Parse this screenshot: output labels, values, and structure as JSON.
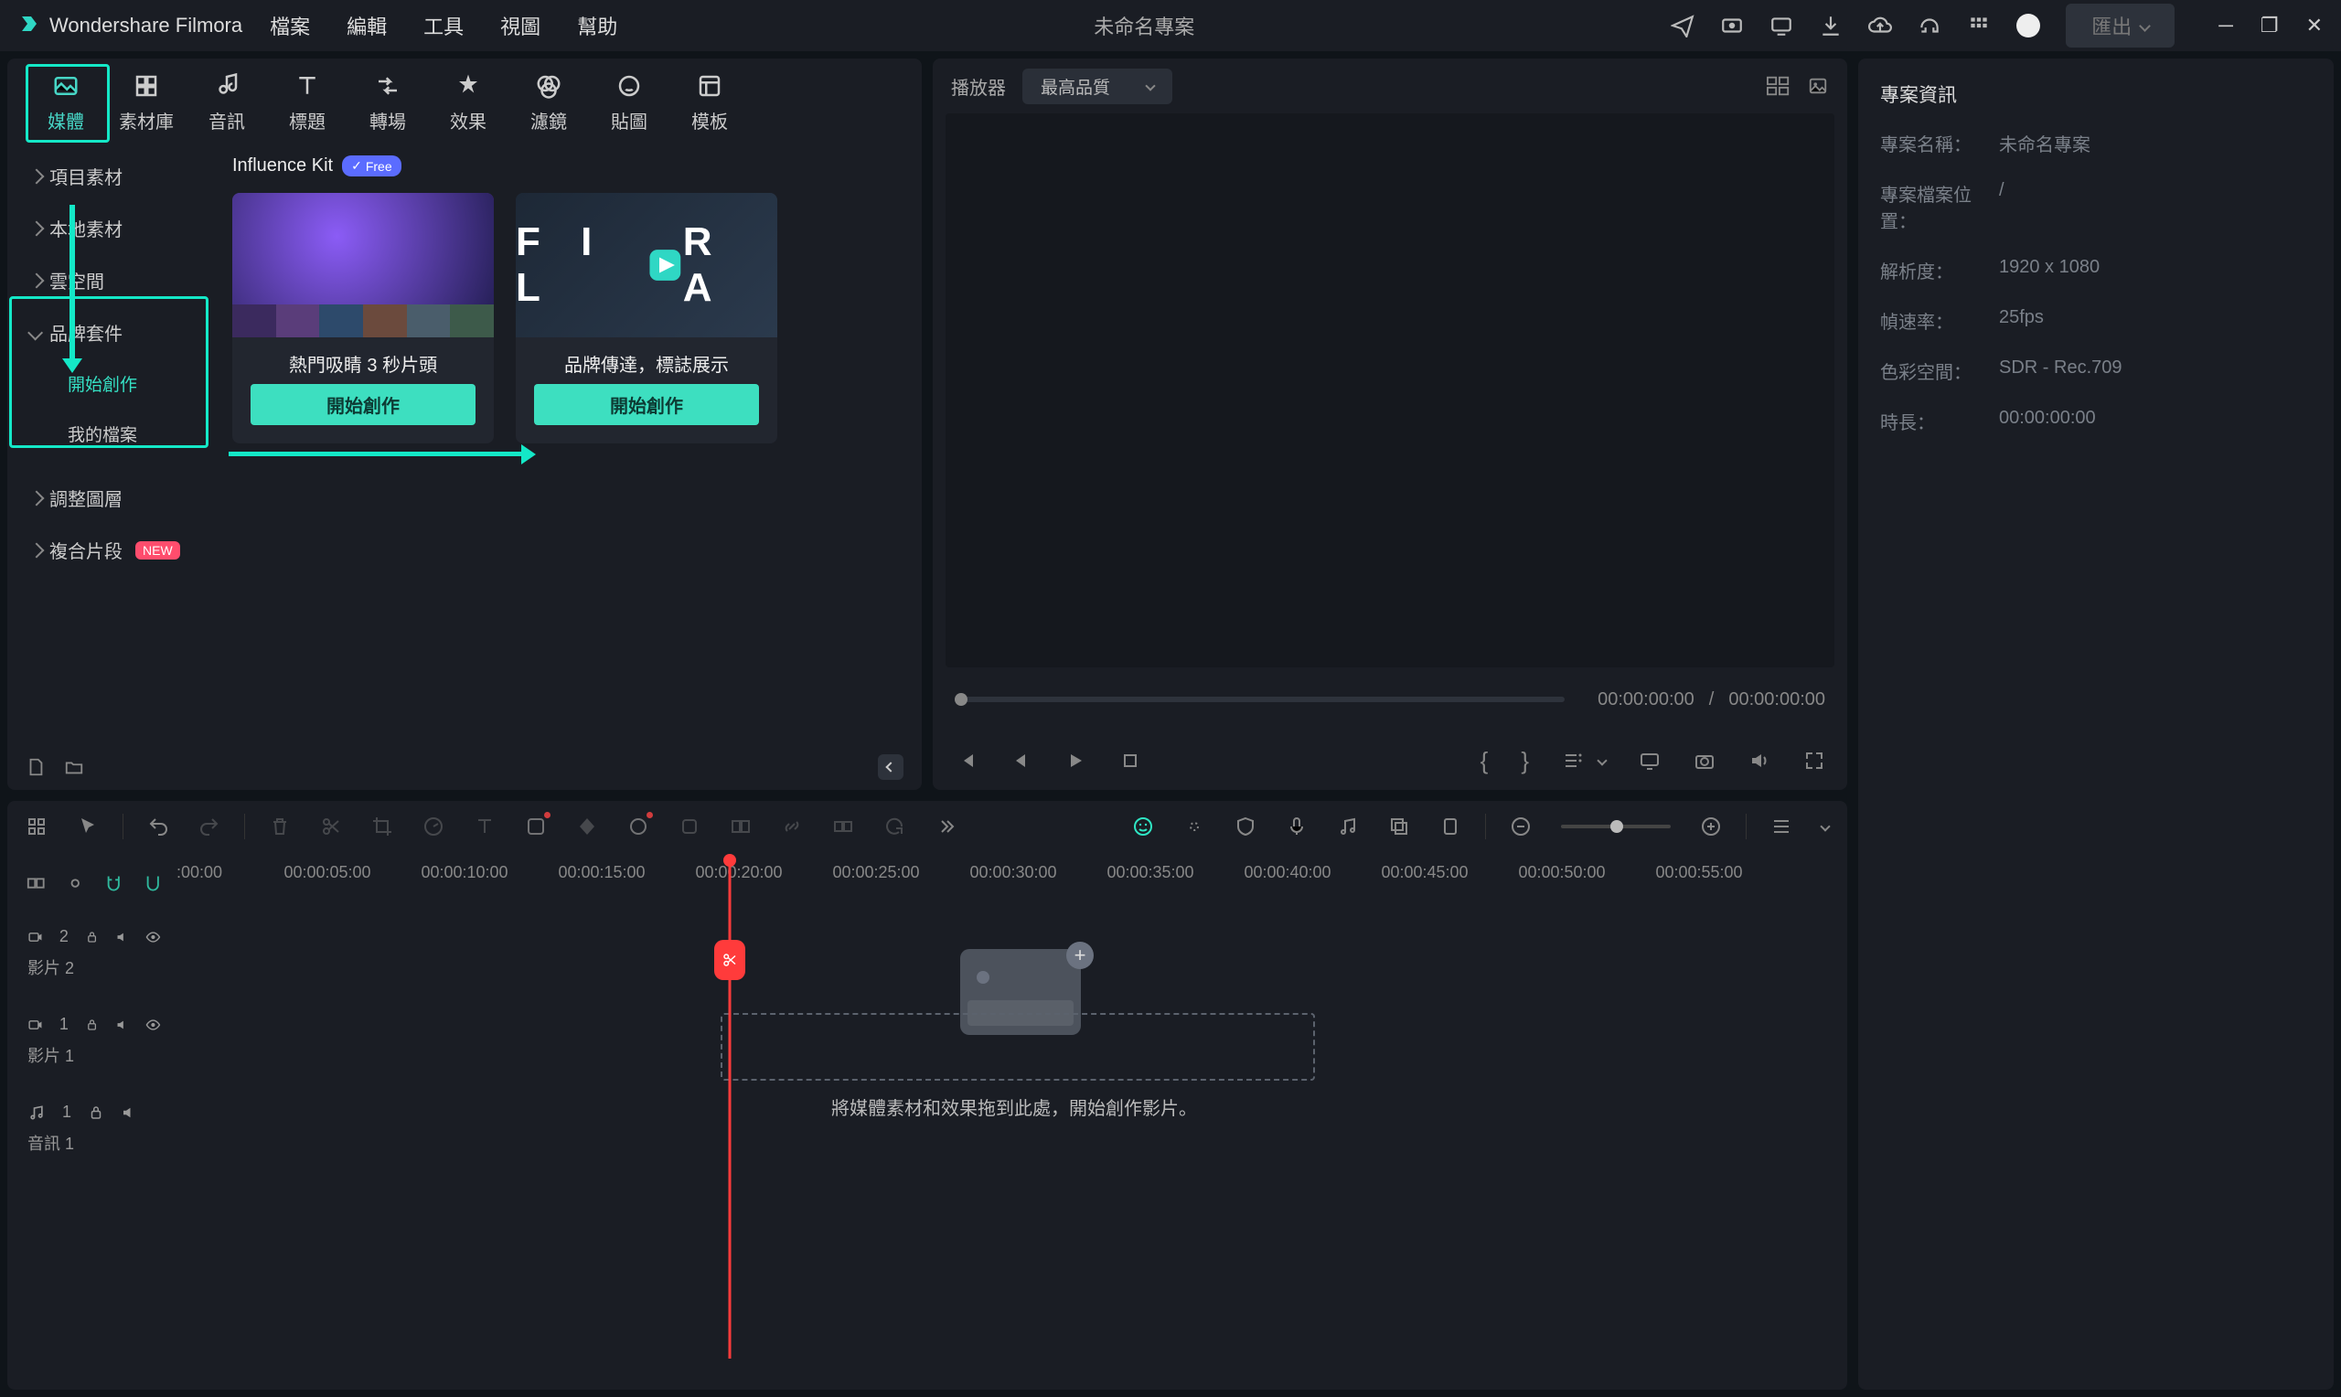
{
  "app": {
    "name": "Wondershare Filmora",
    "project": "未命名專案"
  },
  "menu": {
    "file": "檔案",
    "edit": "編輯",
    "tools": "工具",
    "view": "視圖",
    "help": "幫助"
  },
  "export_label": "匯出",
  "tabs": {
    "media": "媒體",
    "stock": "素材庫",
    "audio": "音訊",
    "title": "標題",
    "transition": "轉場",
    "effect": "效果",
    "filter": "濾鏡",
    "sticker": "貼圖",
    "template": "模板"
  },
  "tree": {
    "project_media": "項目素材",
    "local_media": "本地素材",
    "cloud": "雲空間",
    "brand_kit": "品牌套件",
    "start_create": "開始創作",
    "my_files": "我的檔案",
    "adjust_layer": "調整圖層",
    "compound": "複合片段",
    "new_badge": "NEW"
  },
  "ik": {
    "title": "Influence Kit",
    "free_badge": "Free"
  },
  "cards": {
    "c1": {
      "title": "熱門吸睛 3 秒片頭",
      "btn": "開始創作"
    },
    "c2": {
      "title": "品牌傳達，標誌展示",
      "btn": "開始創作"
    }
  },
  "player": {
    "label": "播放器",
    "quality": "最高品質",
    "time_cur": "00:00:00:00",
    "time_sep": "/",
    "time_tot": "00:00:00:00",
    "brace_l": "{",
    "brace_r": "}"
  },
  "info": {
    "heading": "專案資訊",
    "name_l": "專案名稱：",
    "name_v": "未命名專案",
    "path_l": "專案檔案位置：",
    "path_v": "/",
    "res_l": "解析度：",
    "res_v": "1920 x 1080",
    "fps_l": "幀速率：",
    "fps_v": "25fps",
    "cs_l": "色彩空間：",
    "cs_v": "SDR - Rec.709",
    "dur_l": "時長：",
    "dur_v": "00:00:00:00"
  },
  "timeline": {
    "ruler_00": ":00:00",
    "ruler_labels": [
      "00:00:05:00",
      "00:00:10:00",
      "00:00:15:00",
      "00:00:20:00",
      "00:00:25:00",
      "00:00:30:00",
      "00:00:35:00",
      "00:00:40:00",
      "00:00:45:00",
      "00:00:50:00",
      "00:00:55:00"
    ],
    "track_v2_id": "2",
    "track_v2_name": "影片 2",
    "track_v1_id": "1",
    "track_v1_name": "影片 1",
    "track_a1_id": "1",
    "track_a1_name": "音訊 1",
    "drop_hint": "將媒體素材和效果拖到此處，開始創作影片。"
  }
}
